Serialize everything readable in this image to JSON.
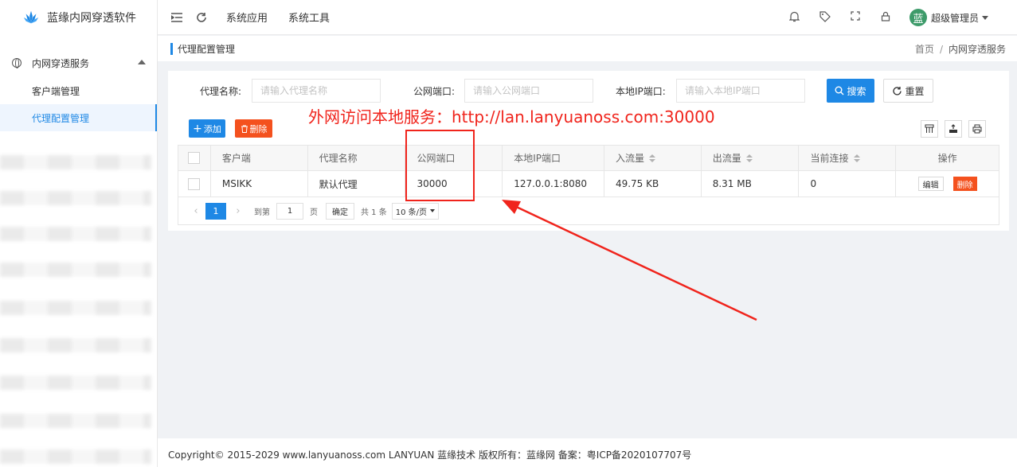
{
  "app": {
    "title": "蓝缘内网穿透软件"
  },
  "sidebar": {
    "group_label": "内网穿透服务",
    "items": [
      {
        "label": "客户端管理",
        "active": false
      },
      {
        "label": "代理配置管理",
        "active": true
      }
    ]
  },
  "topbar": {
    "menus": [
      "系统应用",
      "系统工具"
    ],
    "user_avatar_char": "蓝",
    "user_name": "超级管理员"
  },
  "breadcrumb": {
    "page_title": "代理配置管理",
    "home": "首页",
    "separator": "/",
    "current": "内网穿透服务"
  },
  "search": {
    "name_label": "代理名称:",
    "name_placeholder": "请输入代理名称",
    "port_label": "公网端口:",
    "port_placeholder": "请输入公网端口",
    "local_label": "本地IP端口:",
    "local_placeholder": "请输入本地IP端口",
    "search_button": "搜索",
    "reset_button": "重置"
  },
  "toolbar": {
    "add_button": "添加",
    "delete_button": "删除"
  },
  "table": {
    "headers": [
      "客户端",
      "代理名称",
      "公网端口",
      "本地IP端口",
      "入流量",
      "出流量",
      "当前连接",
      "操作"
    ],
    "rows": [
      {
        "client": "MSIKK",
        "name": "默认代理",
        "public_port": "30000",
        "local_ip_port": "127.0.0.1:8080",
        "inbound": "49.75 KB",
        "outbound": "8.31 MB",
        "connections": "0",
        "edit": "编辑",
        "delete": "删除"
      }
    ]
  },
  "pager": {
    "current_page": "1",
    "goto_label": "到第",
    "goto_value": "1",
    "page_unit": "页",
    "confirm": "确定",
    "total": "共 1 条",
    "page_size": "10 条/页"
  },
  "annotation": {
    "text": "外网访问本地服务：http://lan.lanyuanoss.com:30000",
    "color": "#f0241c"
  },
  "footer": {
    "text": "Copyright© 2015-2029 www.lanyuanoss.com LANYUAN 蓝缘技术 版权所有：蓝缘网 备案：粤ICP备2020107707号"
  },
  "colors": {
    "primary": "#1e88e5",
    "danger": "#f4511e",
    "avatar": "#3d9b6a"
  }
}
